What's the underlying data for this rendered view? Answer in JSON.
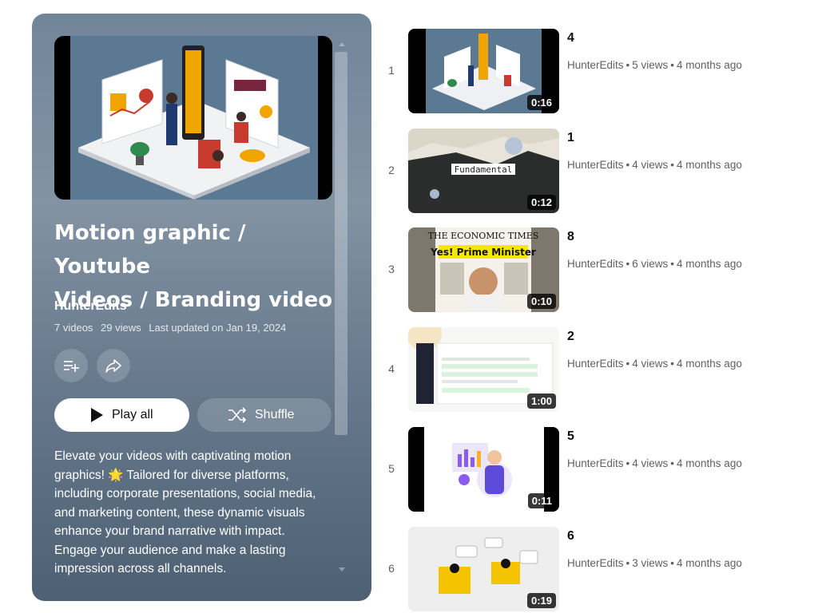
{
  "playlist": {
    "title_line1": "Motion graphic / Youtube",
    "title_line2": "Videos / Branding video",
    "owner": "HunterEdits",
    "video_count": "7 videos",
    "view_count": "29 views",
    "last_updated": "Last updated on Jan 19, 2024",
    "description": "Elevate your videos with captivating motion graphics! 🌟 Tailored for diverse platforms, including corporate presentations, social media, and marketing content, these dynamic visuals enhance your brand narrative with impact. Engage your audience and make a lasting impression across all channels.",
    "actions": {
      "save_icon": "playlist-add-icon",
      "share_icon": "share-icon",
      "play_label": "Play all",
      "shuffle_label": "Shuffle"
    }
  },
  "videos": [
    {
      "index": "1",
      "title": "4",
      "channel": "HunterEdits",
      "views": "5 views",
      "age": "4 months ago",
      "duration": "0:16"
    },
    {
      "index": "2",
      "title": "1",
      "channel": "HunterEdits",
      "views": "4 views",
      "age": "4 months ago",
      "duration": "0:12",
      "thumb_text": "Fundamental"
    },
    {
      "index": "3",
      "title": "8",
      "channel": "HunterEdits",
      "views": "6 views",
      "age": "4 months ago",
      "duration": "0:10",
      "thumb_text_1": "THE ECONOMIC TIMES",
      "thumb_text_2": "Yes! Prime Minister"
    },
    {
      "index": "4",
      "title": "2",
      "channel": "HunterEdits",
      "views": "4 views",
      "age": "4 months ago",
      "duration": "1:00"
    },
    {
      "index": "5",
      "title": "5",
      "channel": "HunterEdits",
      "views": "4 views",
      "age": "4 months ago",
      "duration": "0:11"
    },
    {
      "index": "6",
      "title": "6",
      "channel": "HunterEdits",
      "views": "3 views",
      "age": "4 months ago",
      "duration": "0:19"
    }
  ],
  "colors": {
    "panel_top": "#71859a",
    "panel_bottom": "#4e6174",
    "text_primary": "#0f0f0f",
    "text_secondary": "#606060"
  }
}
